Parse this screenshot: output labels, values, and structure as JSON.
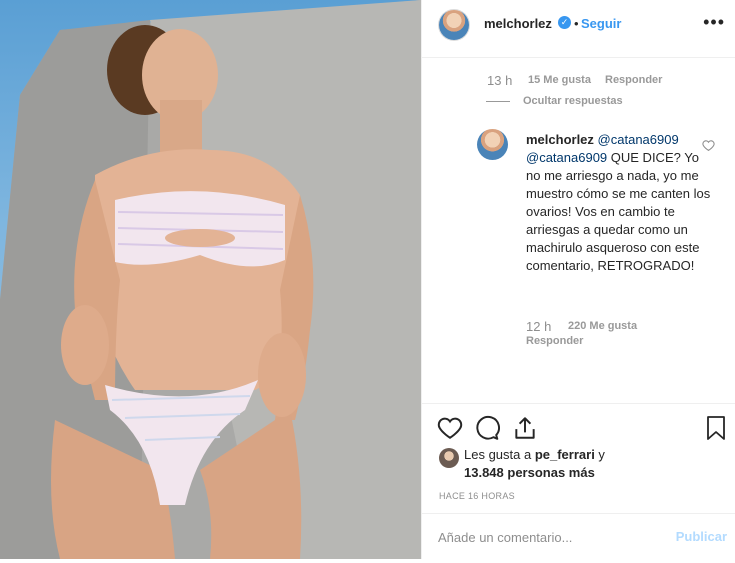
{
  "header": {
    "username": "melchorlez",
    "verified_glyph": "✓",
    "separator": "•",
    "follow_label": "Seguir",
    "more_glyph": "•••"
  },
  "prev_comment": {
    "time": "13 h",
    "likes": "15 Me gusta",
    "reply_label": "Responder",
    "hide_replies_label": "Ocultar respuestas"
  },
  "reply": {
    "username": "melchorlez",
    "mention_1": "@catana6909",
    "mention_2": "@catana6909",
    "text": " QUE DICE? Yo no me arriesgo a nada, yo me muestro cómo se me canten los ovarios! Vos en cambio te arriesgas a quedar como un machirulo asqueroso con este comentario, RETROGRADO!",
    "time": "12 h",
    "likes": "220 Me gusta",
    "reply_label": "Responder"
  },
  "actions": {
    "icons": [
      "heart-icon",
      "comment-icon",
      "share-icon",
      "bookmark-icon"
    ]
  },
  "likes": {
    "prefix": "Les gusta a ",
    "first_user": "pe_ferrari",
    "connector": " y",
    "others": "13.848 personas más"
  },
  "timestamp": "HACE 16 HORAS",
  "add_comment": {
    "placeholder": "Añade un comentario...",
    "publish_label": "Publicar"
  },
  "colors": {
    "accent": "#3897f0",
    "text": "#262626",
    "muted": "#8e8e8e",
    "publish_disabled": "#b3dbff"
  }
}
